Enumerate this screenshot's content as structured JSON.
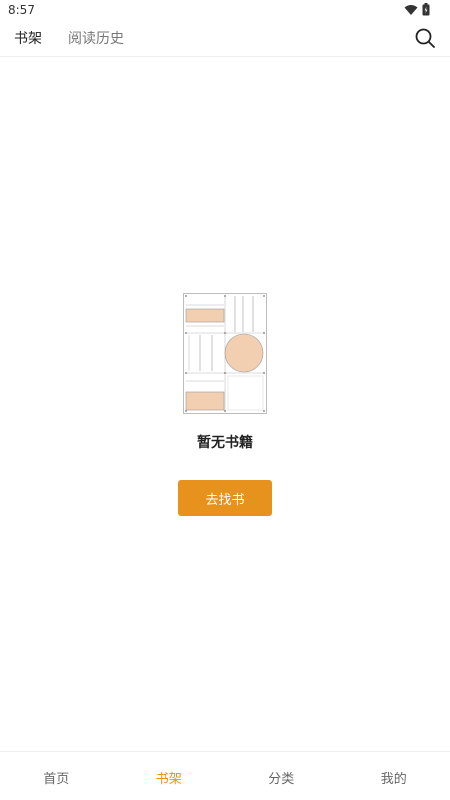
{
  "status_bar": {
    "time": "8:57",
    "icons": [
      "wifi-icon",
      "battery-icon"
    ]
  },
  "top_nav": {
    "tabs": [
      {
        "label": "书架",
        "active": true
      },
      {
        "label": "阅读历史",
        "active": false
      }
    ],
    "search_icon": "search-icon"
  },
  "empty_state": {
    "illustration": "empty-books-illustration",
    "title": "暂无书籍",
    "button_label": "去找书"
  },
  "bottom_nav": {
    "items": [
      {
        "label": "首页",
        "active": false
      },
      {
        "label": "书架",
        "active": true
      },
      {
        "label": "分类",
        "active": false
      },
      {
        "label": "我的",
        "active": false
      }
    ]
  },
  "colors": {
    "accent": "#e8921e",
    "illustration_fill": "#f2cfb1",
    "text_primary": "#222222",
    "text_secondary": "#777777"
  }
}
